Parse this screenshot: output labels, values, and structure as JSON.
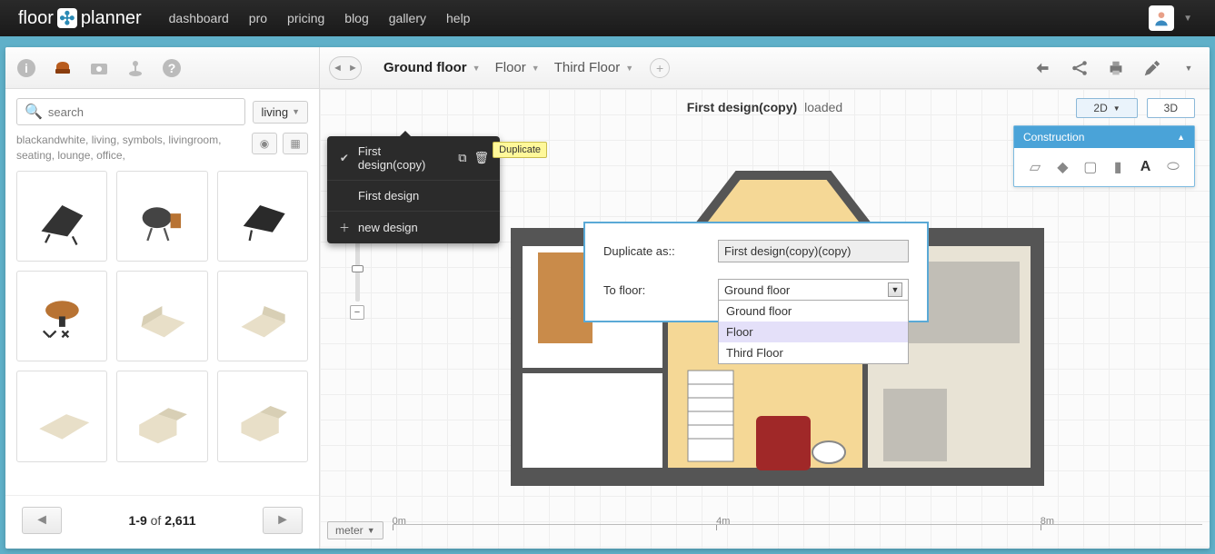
{
  "brand": {
    "left": "floor",
    "right": "planner"
  },
  "topnav": [
    "dashboard",
    "pro",
    "pricing",
    "blog",
    "gallery",
    "help"
  ],
  "sidebar": {
    "search_placeholder": "search",
    "filter": "living",
    "tags": "blackandwhite, living, symbols, livingroom, seating, lounge, office,",
    "pager": {
      "range": "1-9",
      "of": "of",
      "total": "2,611"
    }
  },
  "floors": {
    "tabs": [
      "Ground floor",
      "Floor",
      "Third Floor"
    ],
    "active": 0
  },
  "design_menu": {
    "items": [
      {
        "label": "First design(copy)",
        "checked": true,
        "actions": true
      },
      {
        "label": "First design"
      },
      {
        "label": "new design",
        "add": true
      }
    ],
    "tooltip": "Duplicate"
  },
  "canvas": {
    "title": "First design(copy)",
    "state": "loaded"
  },
  "viewmode": {
    "d2": "2D",
    "d3": "3D"
  },
  "construction": {
    "title": "Construction"
  },
  "dialog": {
    "label_name": "Duplicate as::",
    "value_name": "First design(copy)(copy)",
    "label_floor": "To floor:",
    "selected_floor": "Ground floor",
    "options": [
      "Ground floor",
      "Floor",
      "Third Floor"
    ],
    "hover_index": 1
  },
  "ruler": {
    "unit": "meter",
    "marks": [
      "0m",
      "4m",
      "8m"
    ]
  }
}
